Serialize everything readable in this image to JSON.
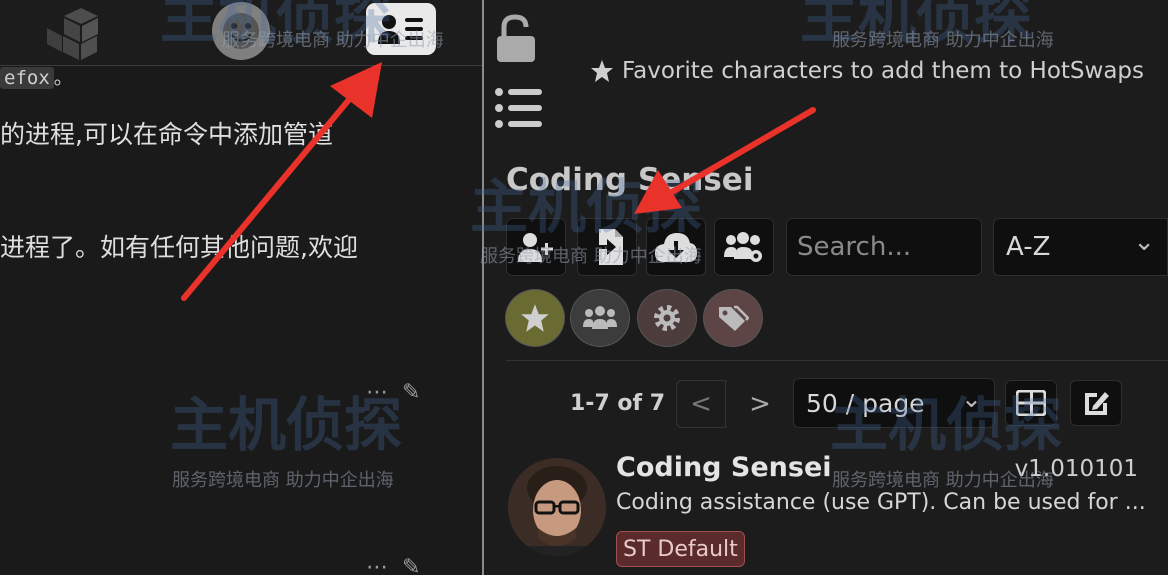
{
  "chat": {
    "code_fragment": "efox",
    "code_suffix": "。",
    "line1": "的进程,可以在命令中添加管道",
    "line2": "进程了。如有任何其他问题,欢迎"
  },
  "panel": {
    "favorite_hint": "Favorite characters to add them to HotSwaps",
    "character_title": "Coding Sensei",
    "search_placeholder": "Search...",
    "sort_value": "A-Z",
    "sort_chevron": "⌄",
    "pagination": {
      "count": "1-7 of 7",
      "prev": "<",
      "next": ">",
      "per_page": "50 / page"
    }
  },
  "character": {
    "name": "Coding Sensei",
    "version": "v1.010101",
    "description": "Coding assistance (use GPT). Can be used for ...",
    "tag": "ST Default"
  },
  "watermark": {
    "slogan": "服务跨境电商 助力中企出海",
    "brand": "主机侦探"
  },
  "colors": {
    "background": "#1b1b1b",
    "annotation_arrow": "#e8322a",
    "favorite_filter": "#6a6a33",
    "tag_border": "#a05050"
  },
  "icons": [
    "extensions-icon",
    "persona-icon",
    "character-management-icon",
    "lock-icon",
    "list-icon",
    "star-icon",
    "create-character-icon",
    "import-character-icon",
    "external-import-icon",
    "create-group-icon",
    "favorites-filter-icon",
    "groups-filter-icon",
    "settings-filter-icon",
    "tags-filter-icon",
    "grid-view-icon",
    "bulk-edit-icon",
    "more-icon",
    "edit-icon"
  ]
}
